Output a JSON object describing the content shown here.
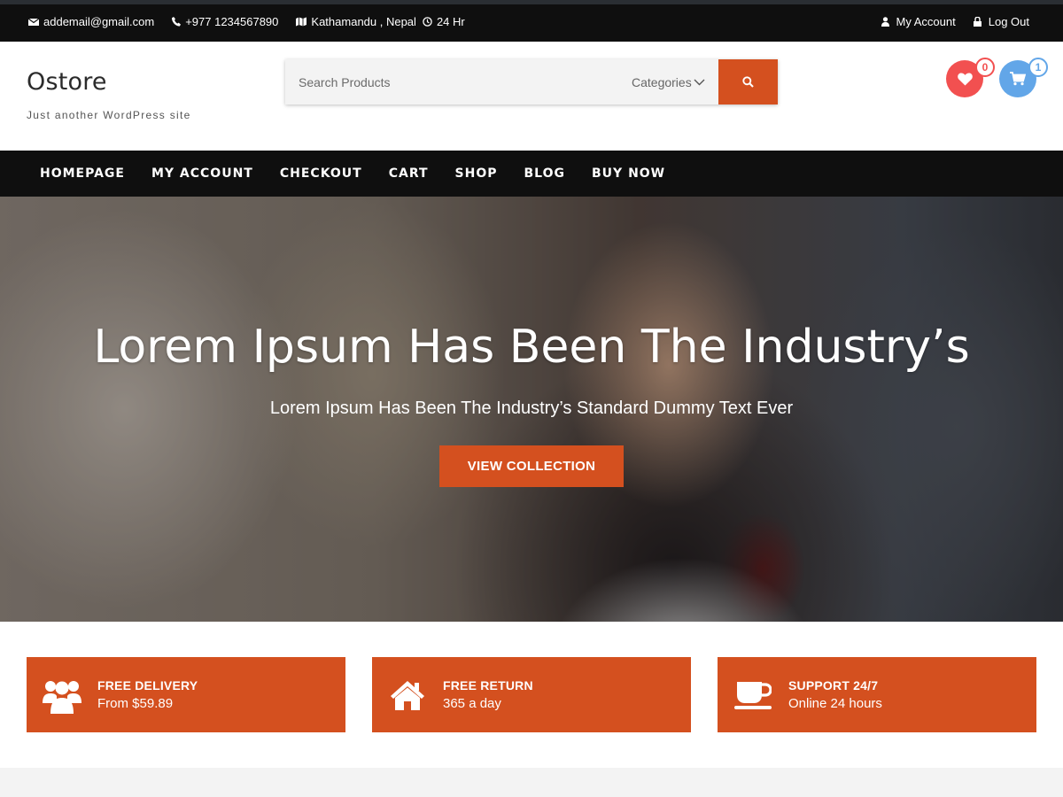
{
  "topbar": {
    "email": "addemail@gmail.com",
    "phone": "+977 1234567890",
    "location": "Kathamandu , Nepal",
    "hours": "24 Hr",
    "my_account": "My Account",
    "logout": "Log Out"
  },
  "header": {
    "site_title": "Ostore",
    "tagline": "Just another WordPress site",
    "search_placeholder": "Search Products",
    "categories_label": "Categories",
    "wishlist_count": "0",
    "cart_count": "1"
  },
  "nav": {
    "items": [
      "HOMEPAGE",
      "MY ACCOUNT",
      "CHECKOUT",
      "CART",
      "SHOP",
      "BLOG",
      "BUY NOW"
    ]
  },
  "hero": {
    "title": "Lorem Ipsum Has Been The Industry’s",
    "subtitle": "Lorem Ipsum Has Been The Industry’s Standard Dummy Text Ever",
    "button": "VIEW COLLECTION"
  },
  "features": [
    {
      "icon": "users-icon",
      "title": "FREE DELIVERY",
      "subtitle": "From $59.89"
    },
    {
      "icon": "home-icon",
      "title": "FREE RETURN",
      "subtitle": "365 a day"
    },
    {
      "icon": "coffee-cup-icon",
      "title": "SUPPORT 24/7",
      "subtitle": "Online 24 hours"
    }
  ],
  "colors": {
    "accent": "#d4501f",
    "dark": "#0f0f0f",
    "wishlist": "#f25050",
    "cart": "#62a6e8"
  }
}
